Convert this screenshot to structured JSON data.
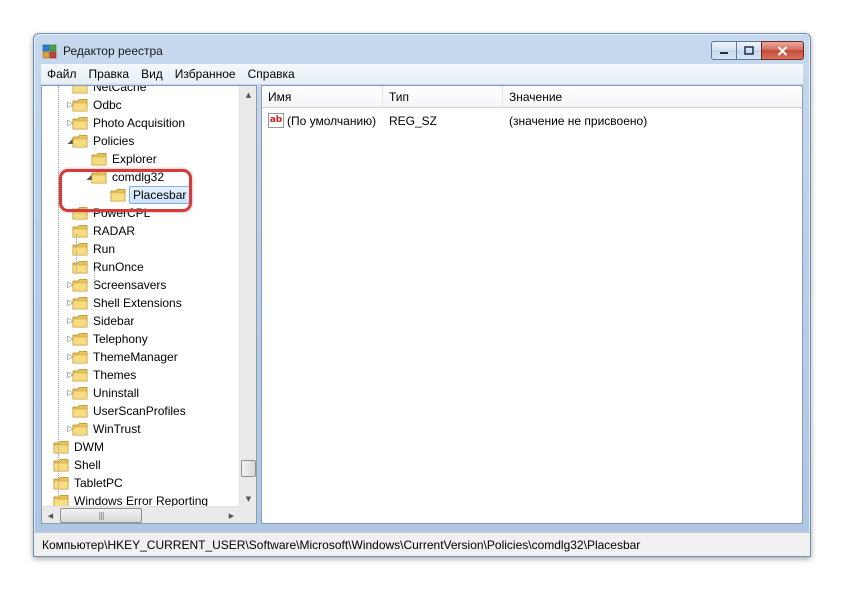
{
  "window": {
    "title": "Редактор реестра",
    "accent": "#d63a3a"
  },
  "menu": [
    "Файл",
    "Правка",
    "Вид",
    "Избранное",
    "Справка"
  ],
  "tree": {
    "items": [
      {
        "label": "NetCache",
        "expander": ""
      },
      {
        "label": "Odbc",
        "expander": "▷"
      },
      {
        "label": "Photo Acquisition",
        "expander": "▷"
      },
      {
        "label": "Policies",
        "expander": "◢"
      },
      {
        "label": "Explorer",
        "expander": ""
      },
      {
        "label": "comdlg32",
        "expander": "◢"
      },
      {
        "label": "Placesbar",
        "expander": "",
        "selected": true
      },
      {
        "label": "PowerCPL",
        "expander": ""
      },
      {
        "label": "RADAR",
        "expander": ""
      },
      {
        "label": "Run",
        "expander": ""
      },
      {
        "label": "RunOnce",
        "expander": ""
      },
      {
        "label": "Screensavers",
        "expander": "▷"
      },
      {
        "label": "Shell Extensions",
        "expander": "▷"
      },
      {
        "label": "Sidebar",
        "expander": "▷"
      },
      {
        "label": "Telephony",
        "expander": "▷"
      },
      {
        "label": "ThemeManager",
        "expander": "▷"
      },
      {
        "label": "Themes",
        "expander": "▷"
      },
      {
        "label": "Uninstall",
        "expander": "▷"
      },
      {
        "label": "UserScanProfiles",
        "expander": ""
      },
      {
        "label": "WinTrust",
        "expander": "▷"
      },
      {
        "label": "DWM",
        "expander": ""
      },
      {
        "label": "Shell",
        "expander": ""
      },
      {
        "label": "TabletPC",
        "expander": ""
      },
      {
        "label": "Windows Error Reporting",
        "expander": ""
      }
    ]
  },
  "list": {
    "columns": [
      "Имя",
      "Тип",
      "Значение"
    ],
    "rows": [
      {
        "name": "(По умолчанию)",
        "type": "REG_SZ",
        "value": "(значение не присвоено)",
        "icon": "string-value-icon"
      }
    ]
  },
  "status": {
    "path": "Компьютер\\HKEY_CURRENT_USER\\Software\\Microsoft\\Windows\\CurrentVersion\\Policies\\comdlg32\\Placesbar"
  }
}
